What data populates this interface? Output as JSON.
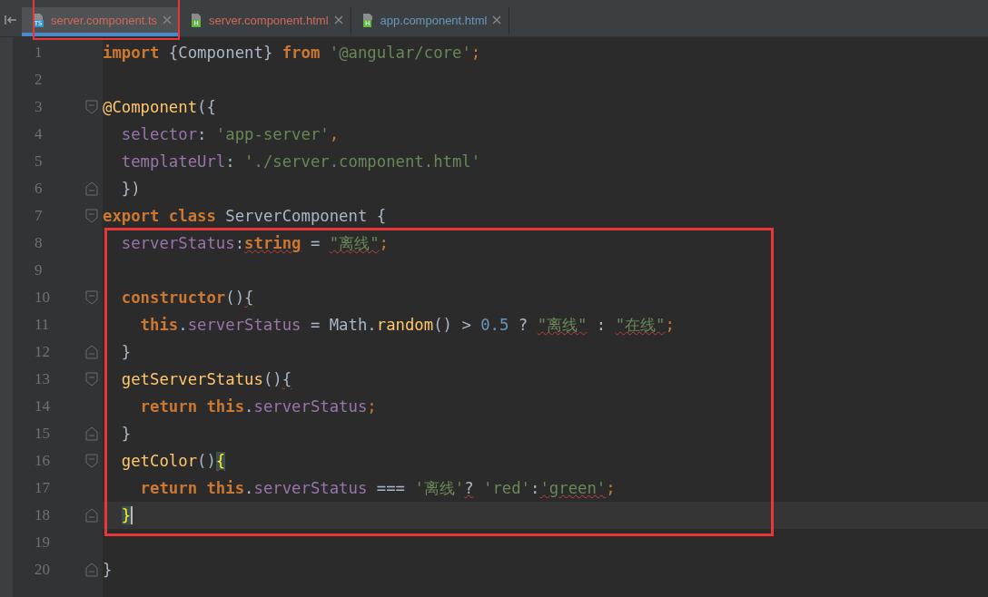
{
  "tabs": [
    {
      "label": "server.component.ts",
      "badge": "TS",
      "color": "#cf6a5a",
      "selected": true,
      "outlined": true
    },
    {
      "label": "server.component.html",
      "badge": "H",
      "color": "#cf6a5a",
      "selected": false,
      "outlined": false
    },
    {
      "label": "app.component.html",
      "badge": "H",
      "color": "#6897bb",
      "selected": false,
      "outlined": false
    }
  ],
  "sections": [
    {
      "boxed": false,
      "lines": [
        {
          "number": "1",
          "kind": "plain",
          "current": false,
          "tokens": [
            {
              "kind": "kw",
              "text": "import"
            },
            {
              "kind": "plain",
              "text": " {Component} "
            },
            {
              "kind": "kw",
              "text": "from"
            },
            {
              "kind": "str",
              "text": " '@angular/core'"
            },
            {
              "kind": "punct",
              "text": ";"
            }
          ]
        },
        {
          "number": "2",
          "kind": "plain",
          "current": false
        },
        {
          "number": "3",
          "kind": "opener",
          "current": false,
          "tokens": [
            {
              "kind": "fn",
              "text": "@Component"
            },
            {
              "kind": "plain",
              "text": "({"
            }
          ]
        },
        {
          "number": "4",
          "kind": "plain",
          "current": false,
          "tokens": [
            {
              "kind": "prop",
              "text": "  selector"
            },
            {
              "kind": "plain",
              "text": ": "
            },
            {
              "kind": "str",
              "text": "'app-server'"
            },
            {
              "kind": "punct",
              "text": ","
            }
          ]
        },
        {
          "number": "5",
          "kind": "plain",
          "current": false,
          "tokens": [
            {
              "kind": "prop",
              "text": "  templateUrl"
            },
            {
              "kind": "plain",
              "text": ": "
            },
            {
              "kind": "str",
              "text": "'./server.component.html'"
            }
          ]
        },
        {
          "number": "6",
          "kind": "closer",
          "current": false,
          "tokens": [
            {
              "kind": "plain",
              "text": "  })"
            }
          ]
        },
        {
          "number": "7",
          "kind": "opener",
          "current": false,
          "tokens": [
            {
              "kind": "kw",
              "text": "export class"
            },
            {
              "kind": "plain",
              "text": " ServerComponent {"
            }
          ]
        }
      ]
    },
    {
      "boxed": true,
      "lines": [
        {
          "number": "8",
          "kind": "plain",
          "current": false,
          "tokens": [
            {
              "kind": "prop",
              "text": "  serverStatus",
              "error": false
            },
            {
              "kind": "plain",
              "text": ":",
              "error": false
            },
            {
              "kind": "kw",
              "text": "string",
              "error": true
            },
            {
              "kind": "plain",
              "text": " = ",
              "error": false
            },
            {
              "kind": "str",
              "text": "\"离线\"",
              "error": true
            },
            {
              "kind": "punct",
              "text": ";",
              "error": false
            }
          ]
        },
        {
          "number": "9",
          "kind": "plain",
          "current": false
        },
        {
          "number": "10",
          "kind": "opener",
          "current": false,
          "tokens": [
            {
              "kind": "kw",
              "text": "  constructor",
              "error": false
            },
            {
              "kind": "plain",
              "text": "()",
              "error": false
            },
            {
              "kind": "plain",
              "text": "{",
              "error": true
            }
          ]
        },
        {
          "number": "11",
          "kind": "plain",
          "current": false,
          "tokens": [
            {
              "kind": "kw",
              "text": "    this",
              "error": false
            },
            {
              "kind": "plain",
              "text": ".",
              "error": false
            },
            {
              "kind": "prop",
              "text": "serverStatus",
              "error": false
            },
            {
              "kind": "plain",
              "text": " = Math.",
              "error": false
            },
            {
              "kind": "fn",
              "text": "random",
              "error": false
            },
            {
              "kind": "plain",
              "text": "() > ",
              "error": false
            },
            {
              "kind": "num",
              "text": "0.5",
              "error": false
            },
            {
              "kind": "plain",
              "text": " ? ",
              "error": false
            },
            {
              "kind": "str",
              "text": "\"离线\"",
              "error": true
            },
            {
              "kind": "plain",
              "text": " : ",
              "error": false
            },
            {
              "kind": "str",
              "text": "\"在线\"",
              "error": true
            },
            {
              "kind": "punct",
              "text": ";",
              "error": false
            }
          ]
        },
        {
          "number": "12",
          "kind": "closer",
          "current": false,
          "tokens": [
            {
              "kind": "plain",
              "text": "  }",
              "error": false
            }
          ]
        },
        {
          "number": "13",
          "kind": "opener",
          "current": false,
          "tokens": [
            {
              "kind": "fn",
              "text": "  getServerStatus",
              "error": false
            },
            {
              "kind": "plain",
              "text": "()",
              "error": false
            },
            {
              "kind": "plain",
              "text": "{",
              "error": true
            }
          ]
        },
        {
          "number": "14",
          "kind": "plain",
          "current": false,
          "tokens": [
            {
              "kind": "kw",
              "text": "    return this",
              "error": false
            },
            {
              "kind": "plain",
              "text": ".",
              "error": false
            },
            {
              "kind": "prop",
              "text": "serverStatus",
              "error": false
            },
            {
              "kind": "punct",
              "text": ";",
              "error": false
            }
          ]
        },
        {
          "number": "15",
          "kind": "closer",
          "current": false,
          "tokens": [
            {
              "kind": "plain",
              "text": "  }",
              "error": false
            }
          ]
        },
        {
          "number": "16",
          "kind": "opener",
          "current": false,
          "tokens": [
            {
              "kind": "fn",
              "text": "  getColor",
              "error": false
            },
            {
              "kind": "plain",
              "text": "()",
              "error": false
            },
            {
              "kind": "match",
              "text": "{",
              "error": true
            }
          ]
        },
        {
          "number": "17",
          "kind": "plain",
          "current": false,
          "tokens": [
            {
              "kind": "kw",
              "text": "    return this",
              "error": false
            },
            {
              "kind": "plain",
              "text": ".",
              "error": false
            },
            {
              "kind": "prop",
              "text": "serverStatus",
              "error": false
            },
            {
              "kind": "plain",
              "text": " === ",
              "error": false
            },
            {
              "kind": "str",
              "text": "'离线'",
              "error": false
            },
            {
              "kind": "plain",
              "text": "?",
              "error": true
            },
            {
              "kind": "str",
              "text": " 'red'",
              "error": false
            },
            {
              "kind": "plain",
              "text": ":",
              "error": false
            },
            {
              "kind": "str",
              "text": "'green'",
              "error": true
            },
            {
              "kind": "punct",
              "text": ";",
              "error": false
            }
          ]
        },
        {
          "number": "18",
          "kind": "closer",
          "current": true,
          "tokens": [
            {
              "kind": "match",
              "text": "  }"
            }
          ]
        }
      ]
    },
    {
      "boxed": false,
      "lines": [
        {
          "number": "19",
          "kind": "plain",
          "current": false
        },
        {
          "number": "20",
          "kind": "closer",
          "current": false,
          "tokens": [
            {
              "kind": "plain",
              "text": "}"
            }
          ]
        }
      ]
    }
  ]
}
